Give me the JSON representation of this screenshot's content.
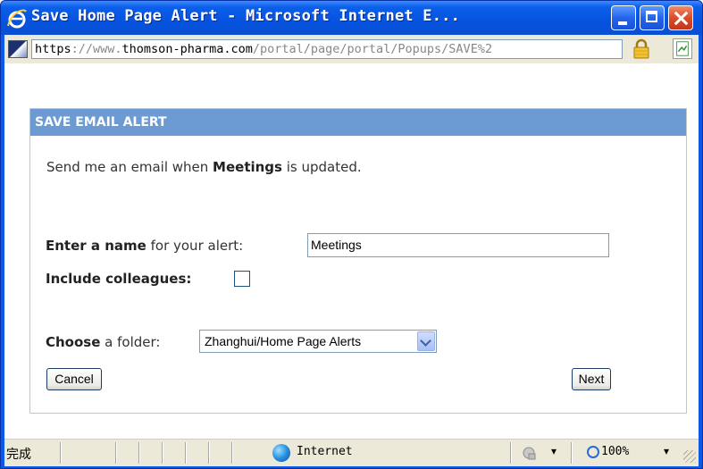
{
  "window": {
    "title": "Save Home Page Alert - Microsoft Internet E...",
    "colors": {
      "titlebar": "#0653e0",
      "panel_header": "#6b9bd2",
      "chrome": "#ece9d8"
    }
  },
  "address": {
    "scheme": "https",
    "sep": "://www.",
    "host": "thomson-pharma.com",
    "path": "/portal/page/portal/Popups/SAVE%2"
  },
  "dialog": {
    "header": "SAVE EMAIL ALERT",
    "intro_prefix": "Send me an email when ",
    "intro_bold": "Meetings",
    "intro_suffix": " is updated.",
    "name_label_bold": "Enter a name",
    "name_label_rest": " for your alert: ",
    "name_value": "Meetings",
    "colleagues_label": "Include colleagues:",
    "colleagues_checked": false,
    "folder_label_bold": "Choose",
    "folder_label_rest": " a folder: ",
    "folder_value": "Zhanghui/Home Page Alerts",
    "cancel_label": "Cancel",
    "next_label": "Next"
  },
  "statusbar": {
    "done": "完成",
    "zone": "Internet",
    "zoom": "100%",
    "dropdown_glyph": "▾"
  },
  "icons": {
    "ie_logo": "ie-logo-icon",
    "site": "site-favicon-icon",
    "lock": "lock-icon",
    "page": "page-report-icon",
    "globe": "globe-icon",
    "zoom": "zoom-icon"
  }
}
